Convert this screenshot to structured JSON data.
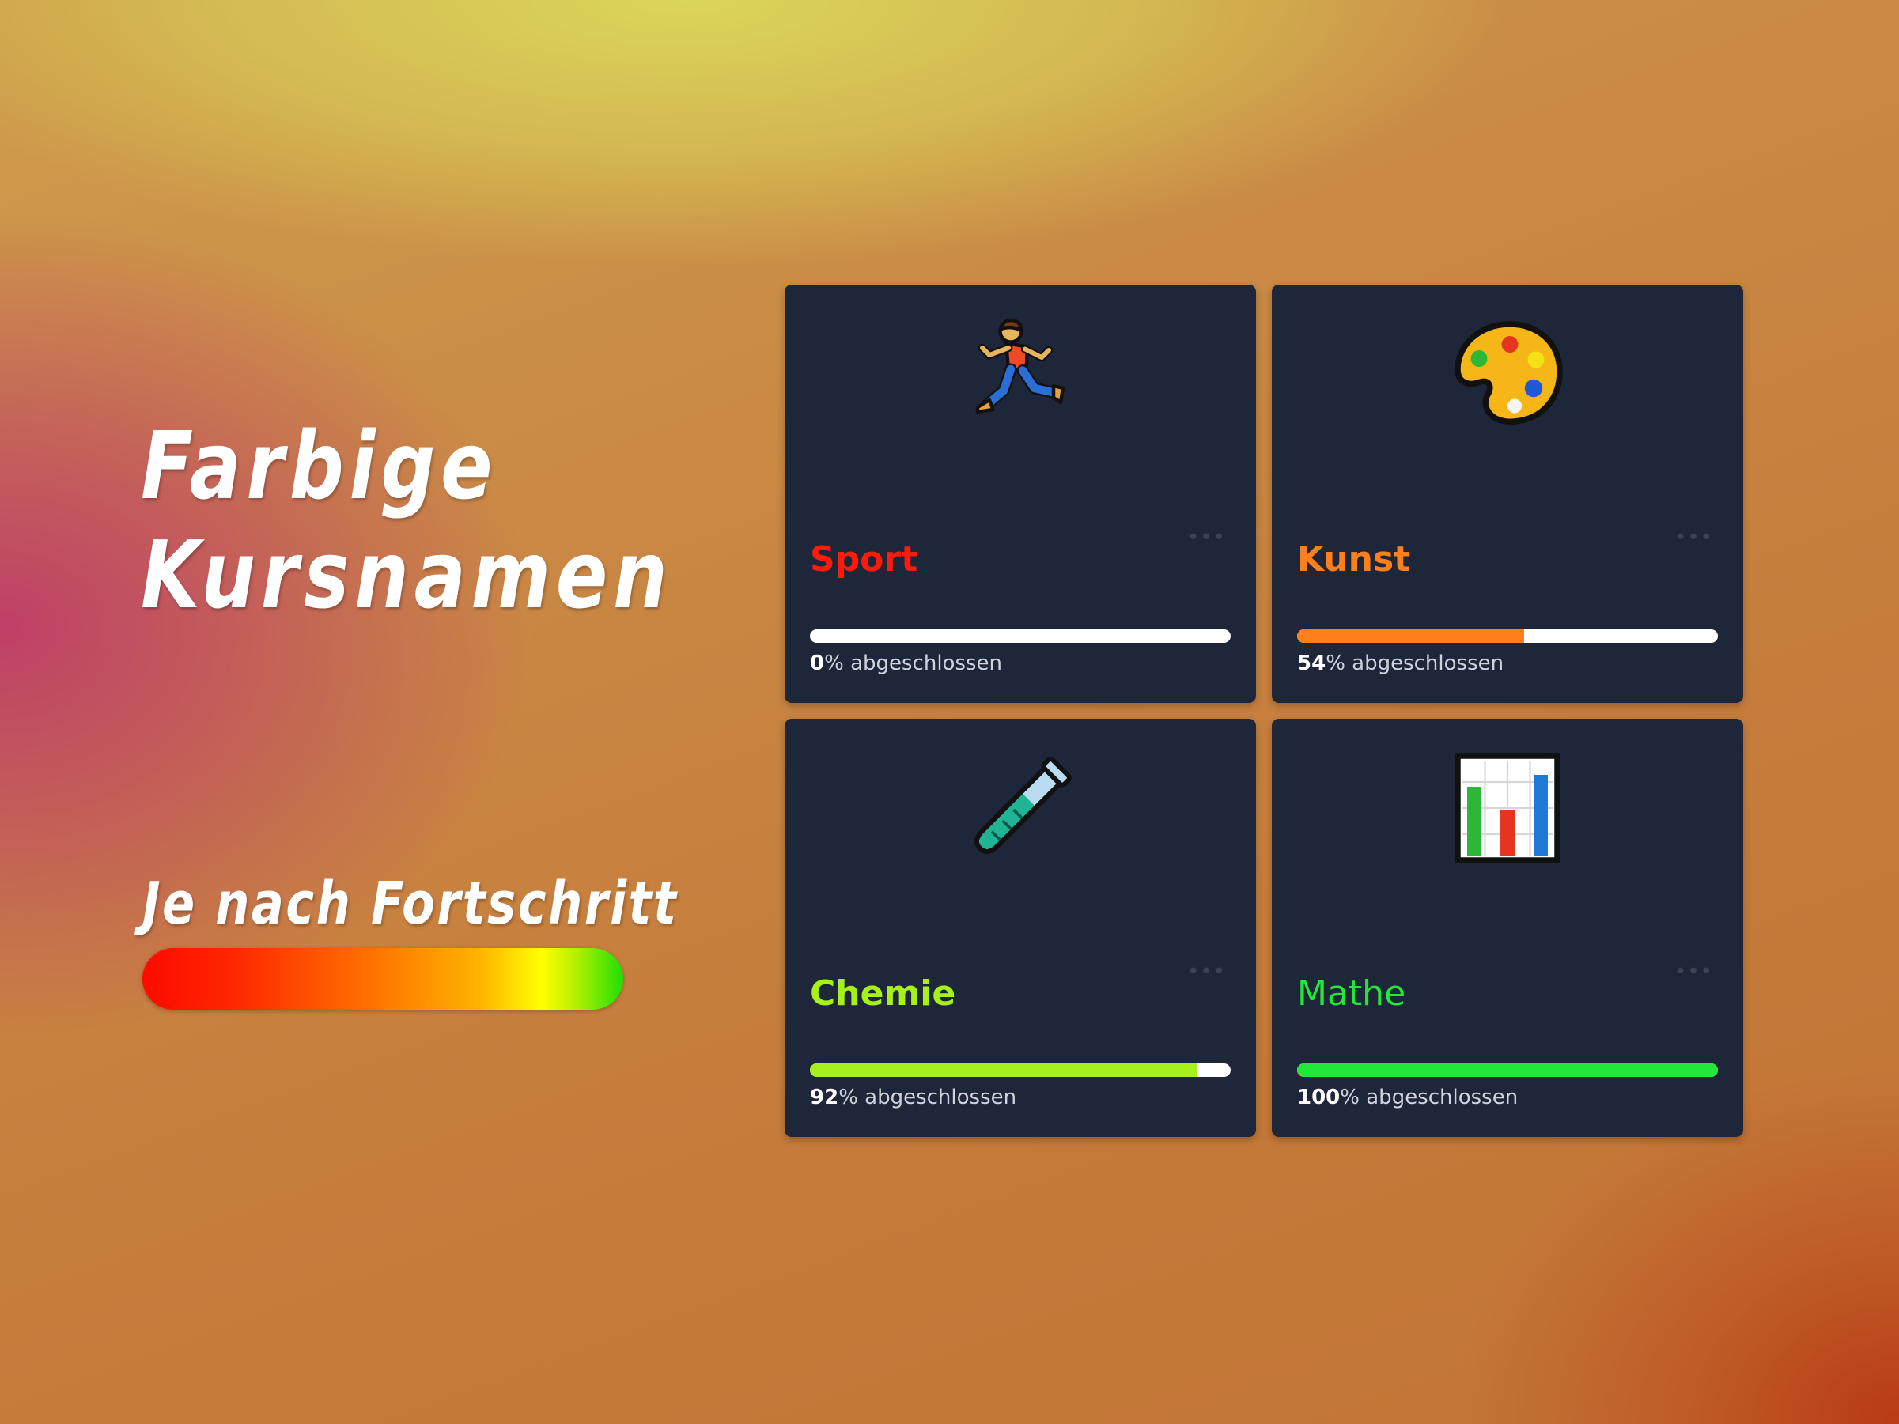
{
  "hero": {
    "title_line1": "Farbige",
    "title_line2": "Kursnamen",
    "subtitle": "Je nach Fortschritt"
  },
  "scale_colors": [
    "#ff0a00",
    "#ff6a00",
    "#ffb200",
    "#ffff00",
    "#1ee000"
  ],
  "courses": [
    {
      "name": "Sport",
      "icon": "running-person-icon",
      "progress": 0,
      "progress_value": "0",
      "progress_suffix": "% abgeschlossen",
      "color": "#ff1a0a",
      "weight": "bold"
    },
    {
      "name": "Kunst",
      "icon": "artist-palette-icon",
      "progress": 54,
      "progress_value": "54",
      "progress_suffix": "% abgeschlossen",
      "color": "#ff7f1a",
      "weight": "bold"
    },
    {
      "name": "Chemie",
      "icon": "test-tube-icon",
      "progress": 92,
      "progress_value": "92",
      "progress_suffix": "% abgeschlossen",
      "color": "#a8f01a",
      "weight": "bold"
    },
    {
      "name": "Mathe",
      "icon": "bar-chart-icon",
      "progress": 100,
      "progress_value": "100",
      "progress_suffix": "% abgeschlossen",
      "color": "#22e83a",
      "weight": "normal"
    }
  ]
}
